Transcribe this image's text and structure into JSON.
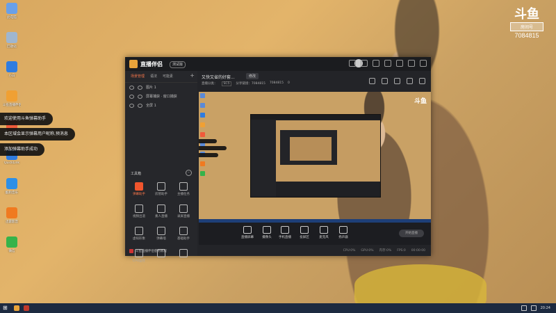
{
  "desktop": {
    "icons": [
      {
        "label": "此电脑",
        "color": "#6aa0e8"
      },
      {
        "label": "回收站",
        "color": "#9fb6cf"
      },
      {
        "label": "小白",
        "color": "#2f7ce0"
      },
      {
        "label": "斗鱼直播伴侣",
        "color": "#f0a033"
      },
      {
        "label": "",
        "color": "#f05a3a"
      },
      {
        "label": "QuickLink",
        "color": "#2f7ce0"
      },
      {
        "label": "酷狗音乐",
        "color": "#2d8fe6"
      },
      {
        "label": "迅雷影音",
        "color": "#f07a20"
      },
      {
        "label": "微信",
        "color": "#36b34a"
      }
    ]
  },
  "brand": {
    "logo": "斗鱼",
    "sub": "房间号",
    "room": "7084815"
  },
  "toasts": [
    "欢迎使用斗鱼弹幕助手",
    "本区域会显示弹幕用户昵称,预消息",
    "添加弹幕助手成功"
  ],
  "window": {
    "app_name": "直播伴侣",
    "version": "测试版",
    "tabs": [
      "场景管理",
      "语法",
      "可能素",
      "+"
    ],
    "scenes": [
      "图片 1",
      "屏幕捕获 · 窗口捕获",
      "全屏 1"
    ],
    "tools_title": "工具箱",
    "tools": [
      {
        "label": "弹幕助手",
        "hot": true
      },
      {
        "label": "房管助手",
        "hot": false
      },
      {
        "label": "主播任务",
        "hot": false
      },
      {
        "label": "视频出道",
        "hot": false
      },
      {
        "label": "素人直播",
        "hot": false
      },
      {
        "label": "录屏直播",
        "hot": false
      },
      {
        "label": "虚拟形象",
        "hot": false
      },
      {
        "label": "弹幕墙",
        "hot": false
      },
      {
        "label": "基础助手",
        "hot": false
      },
      {
        "label": "CPU监控",
        "hot": false
      },
      {
        "label": "",
        "hot": false
      },
      {
        "label": "",
        "hot": false
      }
    ],
    "footer_text": "斗鱼直播伴侣使用教程",
    "room_title": "又快又省的好套...",
    "room_btn": "修改",
    "room_meta": [
      "直播分类：",
      "SC5",
      "分享链接：7084815",
      "7084815",
      "0"
    ],
    "controls": [
      {
        "label": "直播屏幕"
      },
      {
        "label": "摄像头"
      },
      {
        "label": "手机直播"
      },
      {
        "label": "投屏区"
      },
      {
        "label": "麦克风"
      },
      {
        "label": "扬声器"
      }
    ],
    "start_label": "开始直播",
    "status": [
      "CPU:0%",
      "GPU:0%",
      "内存:0%",
      "FPS:0",
      "00:00:00"
    ]
  },
  "taskbar": {
    "time": "20:24"
  }
}
